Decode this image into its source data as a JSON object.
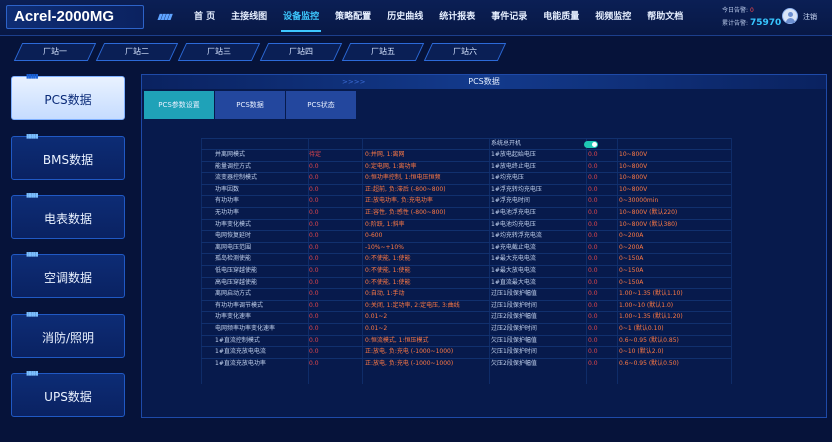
{
  "app": {
    "title": "Acrel-2000MG"
  },
  "nav": {
    "items": [
      {
        "label": "首 页",
        "active": false
      },
      {
        "label": "主接线图",
        "active": false
      },
      {
        "label": "设备监控",
        "active": true
      },
      {
        "label": "策略配置",
        "active": false
      },
      {
        "label": "历史曲线",
        "active": false
      },
      {
        "label": "统计报表",
        "active": false
      },
      {
        "label": "事件记录",
        "active": false
      },
      {
        "label": "电能质量",
        "active": false
      },
      {
        "label": "视频监控",
        "active": false
      },
      {
        "label": "帮助文档",
        "active": false
      }
    ]
  },
  "stats": {
    "today_label": "今日告警",
    "today_value": "0",
    "total_label": "累计告警",
    "total_value": "75970"
  },
  "user": {
    "name": "注销"
  },
  "stations": [
    "厂站一",
    "厂站二",
    "厂站三",
    "厂站四",
    "厂站五",
    "厂站六"
  ],
  "sidebar": {
    "items": [
      {
        "label": "PCS数据",
        "active": true
      },
      {
        "label": "BMS数据",
        "active": false
      },
      {
        "label": "电表数据",
        "active": false
      },
      {
        "label": "空调数据",
        "active": false
      },
      {
        "label": "消防/照明",
        "active": false
      },
      {
        "label": "UPS数据",
        "active": false
      }
    ]
  },
  "panel": {
    "title": "PCS数据",
    "tabs": [
      {
        "label": "PCS参数设置",
        "active": true
      },
      {
        "label": "PCS数据",
        "active": false
      },
      {
        "label": "PCS状态",
        "active": false
      }
    ]
  },
  "colors": {
    "accent": "#3ec8ff",
    "background": "#06133a",
    "value_red": "#e2474c",
    "desc_orange": "#ff7a45",
    "toggle_on": "#1fc7b4"
  },
  "system_switch": {
    "label": "系统总开机",
    "on": true
  },
  "params_left": [
    {
      "name": "并离网模式",
      "value": "待定",
      "desc": "0:并网, 1:离网"
    },
    {
      "name": "能量调控方式",
      "value": "0.0",
      "desc": "0:定电网, 1:离功率"
    },
    {
      "name": "流变器控制模式",
      "value": "0.0",
      "desc": "0:恒功率控制, 1:恒电压恒频"
    },
    {
      "name": "功率因数",
      "value": "0.0",
      "desc": "正:超前, 负:滞后 (-800~800)"
    },
    {
      "name": "有功功率",
      "value": "0.0",
      "desc": "正:放电功率, 负:充电功率"
    },
    {
      "name": "无功功率",
      "value": "0.0",
      "desc": "正:容性, 负:感性 (-800~800)"
    },
    {
      "name": "功率变化模式",
      "value": "0.0",
      "desc": "0:阶跃, 1:斜率"
    },
    {
      "name": "电网恢复延时",
      "value": "0.0",
      "desc": "0-600"
    },
    {
      "name": "离网电压范围",
      "value": "0.0",
      "desc": "-10%~+10%"
    },
    {
      "name": "孤岛检测使能",
      "value": "0.0",
      "desc": "0:不使能, 1:使能"
    },
    {
      "name": "低电压穿越使能",
      "value": "0.0",
      "desc": "0:不使能, 1:使能"
    },
    {
      "name": "高电压穿越使能",
      "value": "0.0",
      "desc": "0:不使能, 1:使能"
    },
    {
      "name": "离网启动方式",
      "value": "0.0",
      "desc": "0:自动, 1:手动"
    },
    {
      "name": "有功功率调节模式",
      "value": "0.0",
      "desc": "0:关闭, 1:定功率, 2:定电压, 3:曲线"
    },
    {
      "name": "功率变化速率",
      "value": "0.0",
      "desc": "0.01~2"
    },
    {
      "name": "电网频率功率变化速率",
      "value": "0.0",
      "desc": "0.01~2"
    },
    {
      "name": "1#直流控制模式",
      "value": "0.0",
      "desc": "0:恒流模式, 1:恒压模式"
    },
    {
      "name": "1#直流充放电电流",
      "value": "0.0",
      "desc": "正:放电, 负:充电 (-1000~1000)"
    },
    {
      "name": "1#直流充放电功率",
      "value": "0.0",
      "desc": "正:放电, 负:充电 (-1000~1000)"
    }
  ],
  "params_right": [
    {
      "name": "1#放电起始电压",
      "value": "0.0",
      "desc": "10~800V"
    },
    {
      "name": "1#放电终止电压",
      "value": "0.0",
      "desc": "10~800V"
    },
    {
      "name": "1#均充电压",
      "value": "0.0",
      "desc": "10~800V"
    },
    {
      "name": "1#浮充转均充电压",
      "value": "0.0",
      "desc": "10~800V"
    },
    {
      "name": "1#浮充电时间",
      "value": "0.0",
      "desc": "0~30000min"
    },
    {
      "name": "1#电池浮充电压",
      "value": "0.0",
      "desc": "10~800V (默认220)"
    },
    {
      "name": "1#电池均充电压",
      "value": "0.0",
      "desc": "10~800V (默认380)"
    },
    {
      "name": "1#均充转浮充电流",
      "value": "0.0",
      "desc": "0~200A"
    },
    {
      "name": "1#充电截止电流",
      "value": "0.0",
      "desc": "0~200A"
    },
    {
      "name": "1#最大充电电流",
      "value": "0.0",
      "desc": "0~150A"
    },
    {
      "name": "1#最大放电电流",
      "value": "0.0",
      "desc": "0~150A"
    },
    {
      "name": "1#直流最大电流",
      "value": "0.0",
      "desc": "0~150A"
    },
    {
      "name": "过压1段保护幅值",
      "value": "0.0",
      "desc": "1.00~1.35 (默认1.10)"
    },
    {
      "name": "过压1段保护时间",
      "value": "0.0",
      "desc": "1.00~10 (默认1.0)"
    },
    {
      "name": "过压2段保护幅值",
      "value": "0.0",
      "desc": "1.00~1.35 (默认1.20)"
    },
    {
      "name": "过压2段保护时间",
      "value": "0.0",
      "desc": "0~1 (默认0.10)"
    },
    {
      "name": "欠压1段保护幅值",
      "value": "0.0",
      "desc": "0.6~0.95 (默认0.85)"
    },
    {
      "name": "欠压1段保护时间",
      "value": "0.0",
      "desc": "0~10 (默认2.0)"
    },
    {
      "name": "欠压2段保护幅值",
      "value": "0.0",
      "desc": "0.6~0.95 (默认0.50)"
    }
  ]
}
